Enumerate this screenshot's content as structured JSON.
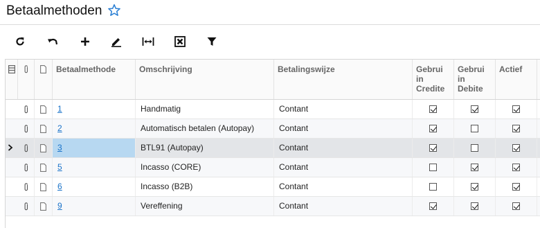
{
  "page": {
    "title": "Betaalmethoden"
  },
  "toolbar": {
    "buttons": [
      {
        "name": "refresh-button",
        "icon": "refresh-icon"
      },
      {
        "name": "undo-button",
        "icon": "undo-icon"
      },
      {
        "name": "add-button",
        "icon": "plus-icon"
      },
      {
        "name": "edit-button",
        "icon": "pencil-icon"
      },
      {
        "name": "fit-width-button",
        "icon": "fit-width-icon"
      },
      {
        "name": "export-excel-button",
        "icon": "excel-icon"
      },
      {
        "name": "filter-button",
        "icon": "filter-icon"
      }
    ]
  },
  "grid": {
    "columns": {
      "betaalmethode": "Betaalmethode",
      "omschrijving": "Omschrijving",
      "betalingswijze": "Betalingswijze",
      "gebruikt_crediteuren": "Gebrui in Credite",
      "gebruikt_debiteuren": "Gebrui in Debite",
      "actief": "Actief"
    },
    "rows": [
      {
        "code": "1",
        "omschrijving": "Handmatig",
        "betalingswijze": "Contant",
        "crediteuren": true,
        "debiteuren": true,
        "actief": true
      },
      {
        "code": "2",
        "omschrijving": "Automatisch betalen (Autopay)",
        "betalingswijze": "Contant",
        "crediteuren": true,
        "debiteuren": false,
        "actief": true
      },
      {
        "code": "3",
        "omschrijving": "BTL91 (Autopay)",
        "betalingswijze": "Contant",
        "crediteuren": true,
        "debiteuren": false,
        "actief": true
      },
      {
        "code": "5",
        "omschrijving": "Incasso (CORE)",
        "betalingswijze": "Contant",
        "crediteuren": false,
        "debiteuren": true,
        "actief": true
      },
      {
        "code": "6",
        "omschrijving": "Incasso (B2B)",
        "betalingswijze": "Contant",
        "crediteuren": false,
        "debiteuren": true,
        "actief": true
      },
      {
        "code": "9",
        "omschrijving": "Vereffening",
        "betalingswijze": "Contant",
        "crediteuren": true,
        "debiteuren": true,
        "actief": true
      }
    ],
    "selected_row": 2
  },
  "colors": {
    "accent": "#1a73c9",
    "selected_key": "#b7d8f1",
    "selected_row": "#e3e5e8"
  }
}
